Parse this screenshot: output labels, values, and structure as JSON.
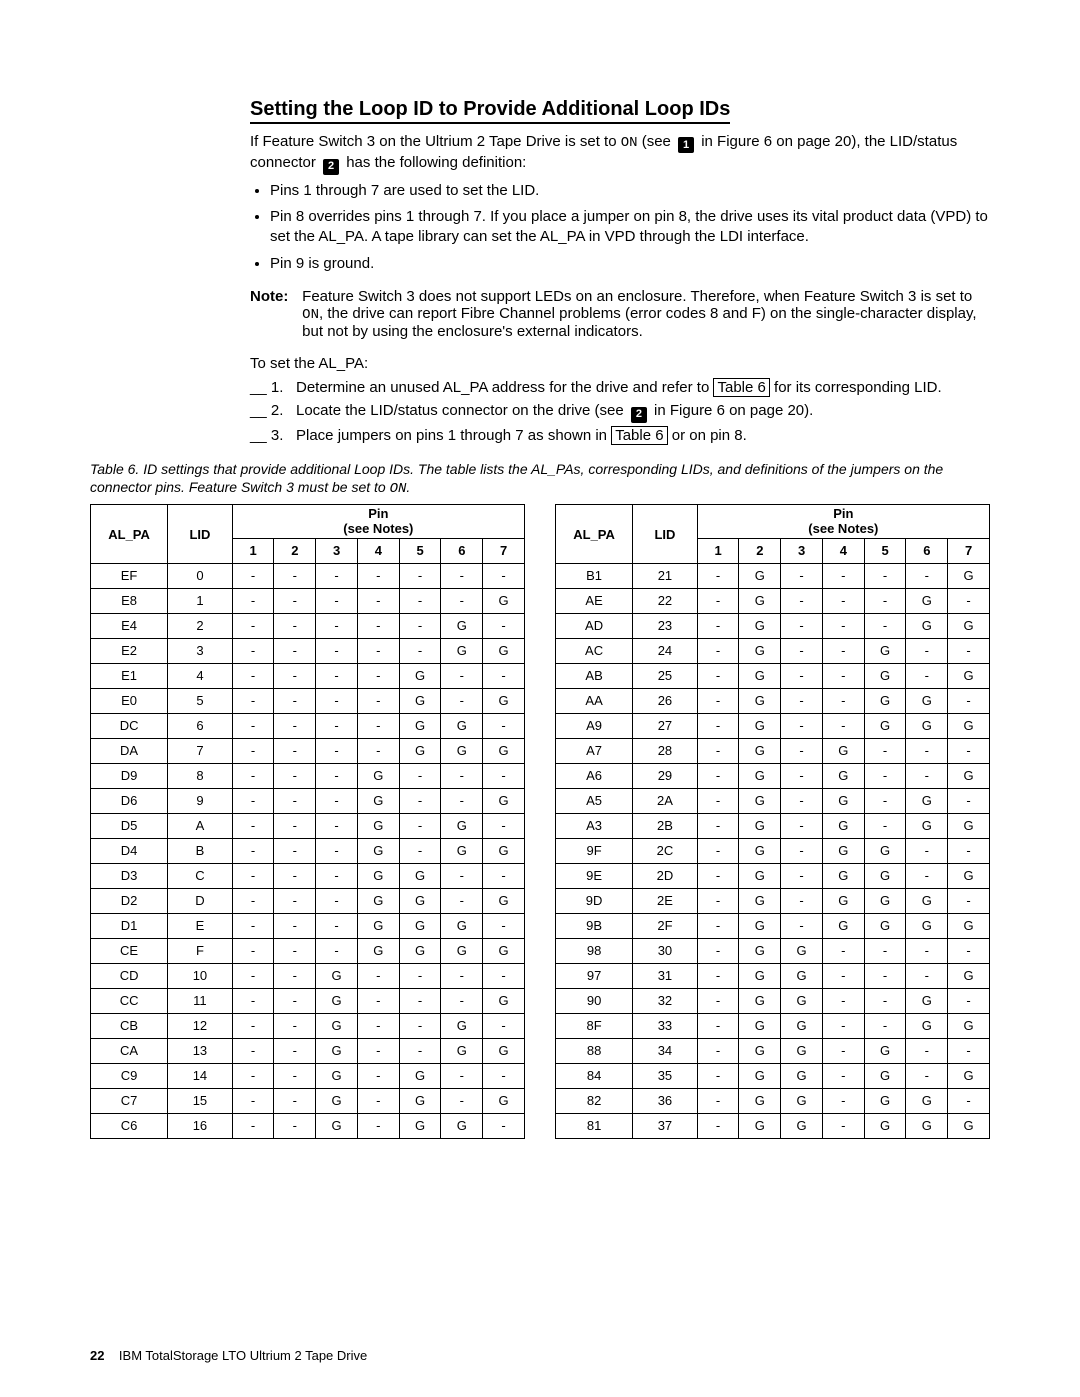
{
  "heading": "Setting the Loop ID to Provide Additional Loop IDs",
  "intro": {
    "p1a": "If Feature Switch 3 on the Ultrium 2 Tape Drive is set to ",
    "on_code": "ON",
    "p1b": " (see ",
    "callout1": "1",
    "p1c": " in Figure 6 on page 20), the LID/status connector ",
    "callout2": "2",
    "p1d": " has the following definition:"
  },
  "bullets": [
    "Pins 1 through 7 are used to set the LID.",
    "Pin 8 overrides pins 1 through 7. If you place a jumper on pin 8, the drive uses its vital product data (VPD) to set the AL_PA. A tape library can set the AL_PA in VPD through the LDI interface.",
    "Pin 9 is ground."
  ],
  "note": {
    "label": "Note:",
    "a": "Feature Switch 3 does not support LEDs on an enclosure. Therefore, when Feature Switch 3 is set to ",
    "on_code": "ON",
    "b": ", the drive can report Fibre Channel problems (error codes 8 and F) on the single-character display, but not by using the enclosure's external indicators."
  },
  "to_set_line": "To set the AL_PA:",
  "steps": {
    "s1_mark": "__ 1.",
    "s1a": "Determine an unused AL_PA address for the drive and refer to ",
    "s1_link": "Table 6",
    "s1b": " for its corresponding LID.",
    "s2_mark": "__ 2.",
    "s2a": "Locate the LID/status connector on the drive (see ",
    "s2_callout": "2",
    "s2b": " in Figure 6 on page 20).",
    "s3_mark": "__ 3.",
    "s3a": "Place jumpers on pins 1 through 7 as shown in ",
    "s3_link": "Table 6",
    "s3b": " or on pin 8."
  },
  "table_caption": "Table 6. ID settings that provide additional Loop IDs.  The table lists the AL_PAs, corresponding LIDs, and definitions of the jumpers on the connector pins. Feature Switch 3 must be set to ",
  "table_caption_on": "ON",
  "table_caption_end": ".",
  "th": {
    "alpa": "AL_PA",
    "lid": "LID",
    "pin_top": "Pin",
    "pin_sub": "(see Notes)"
  },
  "pin_numbers": [
    "1",
    "2",
    "3",
    "4",
    "5",
    "6",
    "7"
  ],
  "left_rows": [
    {
      "alpa": "EF",
      "lid": "0",
      "p": [
        "-",
        "-",
        "-",
        "-",
        "-",
        "-",
        "-"
      ]
    },
    {
      "alpa": "E8",
      "lid": "1",
      "p": [
        "-",
        "-",
        "-",
        "-",
        "-",
        "-",
        "G"
      ]
    },
    {
      "alpa": "E4",
      "lid": "2",
      "p": [
        "-",
        "-",
        "-",
        "-",
        "-",
        "G",
        "-"
      ]
    },
    {
      "alpa": "E2",
      "lid": "3",
      "p": [
        "-",
        "-",
        "-",
        "-",
        "-",
        "G",
        "G"
      ]
    },
    {
      "alpa": "E1",
      "lid": "4",
      "p": [
        "-",
        "-",
        "-",
        "-",
        "G",
        "-",
        "-"
      ]
    },
    {
      "alpa": "E0",
      "lid": "5",
      "p": [
        "-",
        "-",
        "-",
        "-",
        "G",
        "-",
        "G"
      ]
    },
    {
      "alpa": "DC",
      "lid": "6",
      "p": [
        "-",
        "-",
        "-",
        "-",
        "G",
        "G",
        "-"
      ]
    },
    {
      "alpa": "DA",
      "lid": "7",
      "p": [
        "-",
        "-",
        "-",
        "-",
        "G",
        "G",
        "G"
      ]
    },
    {
      "alpa": "D9",
      "lid": "8",
      "p": [
        "-",
        "-",
        "-",
        "G",
        "-",
        "-",
        "-"
      ]
    },
    {
      "alpa": "D6",
      "lid": "9",
      "p": [
        "-",
        "-",
        "-",
        "G",
        "-",
        "-",
        "G"
      ]
    },
    {
      "alpa": "D5",
      "lid": "A",
      "p": [
        "-",
        "-",
        "-",
        "G",
        "-",
        "G",
        "-"
      ]
    },
    {
      "alpa": "D4",
      "lid": "B",
      "p": [
        "-",
        "-",
        "-",
        "G",
        "-",
        "G",
        "G"
      ]
    },
    {
      "alpa": "D3",
      "lid": "C",
      "p": [
        "-",
        "-",
        "-",
        "G",
        "G",
        "-",
        "-"
      ]
    },
    {
      "alpa": "D2",
      "lid": "D",
      "p": [
        "-",
        "-",
        "-",
        "G",
        "G",
        "-",
        "G"
      ]
    },
    {
      "alpa": "D1",
      "lid": "E",
      "p": [
        "-",
        "-",
        "-",
        "G",
        "G",
        "G",
        "-"
      ]
    },
    {
      "alpa": "CE",
      "lid": "F",
      "p": [
        "-",
        "-",
        "-",
        "G",
        "G",
        "G",
        "G"
      ]
    },
    {
      "alpa": "CD",
      "lid": "10",
      "p": [
        "-",
        "-",
        "G",
        "-",
        "-",
        "-",
        "-"
      ]
    },
    {
      "alpa": "CC",
      "lid": "11",
      "p": [
        "-",
        "-",
        "G",
        "-",
        "-",
        "-",
        "G"
      ]
    },
    {
      "alpa": "CB",
      "lid": "12",
      "p": [
        "-",
        "-",
        "G",
        "-",
        "-",
        "G",
        "-"
      ]
    },
    {
      "alpa": "CA",
      "lid": "13",
      "p": [
        "-",
        "-",
        "G",
        "-",
        "-",
        "G",
        "G"
      ]
    },
    {
      "alpa": "C9",
      "lid": "14",
      "p": [
        "-",
        "-",
        "G",
        "-",
        "G",
        "-",
        "-"
      ]
    },
    {
      "alpa": "C7",
      "lid": "15",
      "p": [
        "-",
        "-",
        "G",
        "-",
        "G",
        "-",
        "G"
      ]
    },
    {
      "alpa": "C6",
      "lid": "16",
      "p": [
        "-",
        "-",
        "G",
        "-",
        "G",
        "G",
        "-"
      ]
    }
  ],
  "right_rows": [
    {
      "alpa": "B1",
      "lid": "21",
      "p": [
        "-",
        "G",
        "-",
        "-",
        "-",
        "-",
        "G"
      ]
    },
    {
      "alpa": "AE",
      "lid": "22",
      "p": [
        "-",
        "G",
        "-",
        "-",
        "-",
        "G",
        "-"
      ]
    },
    {
      "alpa": "AD",
      "lid": "23",
      "p": [
        "-",
        "G",
        "-",
        "-",
        "-",
        "G",
        "G"
      ]
    },
    {
      "alpa": "AC",
      "lid": "24",
      "p": [
        "-",
        "G",
        "-",
        "-",
        "G",
        "-",
        "-"
      ]
    },
    {
      "alpa": "AB",
      "lid": "25",
      "p": [
        "-",
        "G",
        "-",
        "-",
        "G",
        "-",
        "G"
      ]
    },
    {
      "alpa": "AA",
      "lid": "26",
      "p": [
        "-",
        "G",
        "-",
        "-",
        "G",
        "G",
        "-"
      ]
    },
    {
      "alpa": "A9",
      "lid": "27",
      "p": [
        "-",
        "G",
        "-",
        "-",
        "G",
        "G",
        "G"
      ]
    },
    {
      "alpa": "A7",
      "lid": "28",
      "p": [
        "-",
        "G",
        "-",
        "G",
        "-",
        "-",
        "-"
      ]
    },
    {
      "alpa": "A6",
      "lid": "29",
      "p": [
        "-",
        "G",
        "-",
        "G",
        "-",
        "-",
        "G"
      ]
    },
    {
      "alpa": "A5",
      "lid": "2A",
      "p": [
        "-",
        "G",
        "-",
        "G",
        "-",
        "G",
        "-"
      ]
    },
    {
      "alpa": "A3",
      "lid": "2B",
      "p": [
        "-",
        "G",
        "-",
        "G",
        "-",
        "G",
        "G"
      ]
    },
    {
      "alpa": "9F",
      "lid": "2C",
      "p": [
        "-",
        "G",
        "-",
        "G",
        "G",
        "-",
        "-"
      ]
    },
    {
      "alpa": "9E",
      "lid": "2D",
      "p": [
        "-",
        "G",
        "-",
        "G",
        "G",
        "-",
        "G"
      ]
    },
    {
      "alpa": "9D",
      "lid": "2E",
      "p": [
        "-",
        "G",
        "-",
        "G",
        "G",
        "G",
        "-"
      ]
    },
    {
      "alpa": "9B",
      "lid": "2F",
      "p": [
        "-",
        "G",
        "-",
        "G",
        "G",
        "G",
        "G"
      ]
    },
    {
      "alpa": "98",
      "lid": "30",
      "p": [
        "-",
        "G",
        "G",
        "-",
        "-",
        "-",
        "-"
      ]
    },
    {
      "alpa": "97",
      "lid": "31",
      "p": [
        "-",
        "G",
        "G",
        "-",
        "-",
        "-",
        "G"
      ]
    },
    {
      "alpa": "90",
      "lid": "32",
      "p": [
        "-",
        "G",
        "G",
        "-",
        "-",
        "G",
        "-"
      ]
    },
    {
      "alpa": "8F",
      "lid": "33",
      "p": [
        "-",
        "G",
        "G",
        "-",
        "-",
        "G",
        "G"
      ]
    },
    {
      "alpa": "88",
      "lid": "34",
      "p": [
        "-",
        "G",
        "G",
        "-",
        "G",
        "-",
        "-"
      ]
    },
    {
      "alpa": "84",
      "lid": "35",
      "p": [
        "-",
        "G",
        "G",
        "-",
        "G",
        "-",
        "G"
      ]
    },
    {
      "alpa": "82",
      "lid": "36",
      "p": [
        "-",
        "G",
        "G",
        "-",
        "G",
        "G",
        "-"
      ]
    },
    {
      "alpa": "81",
      "lid": "37",
      "p": [
        "-",
        "G",
        "G",
        "-",
        "G",
        "G",
        "G"
      ]
    }
  ],
  "footer": {
    "page": "22",
    "title": "IBM TotalStorage LTO Ultrium 2 Tape Drive"
  }
}
